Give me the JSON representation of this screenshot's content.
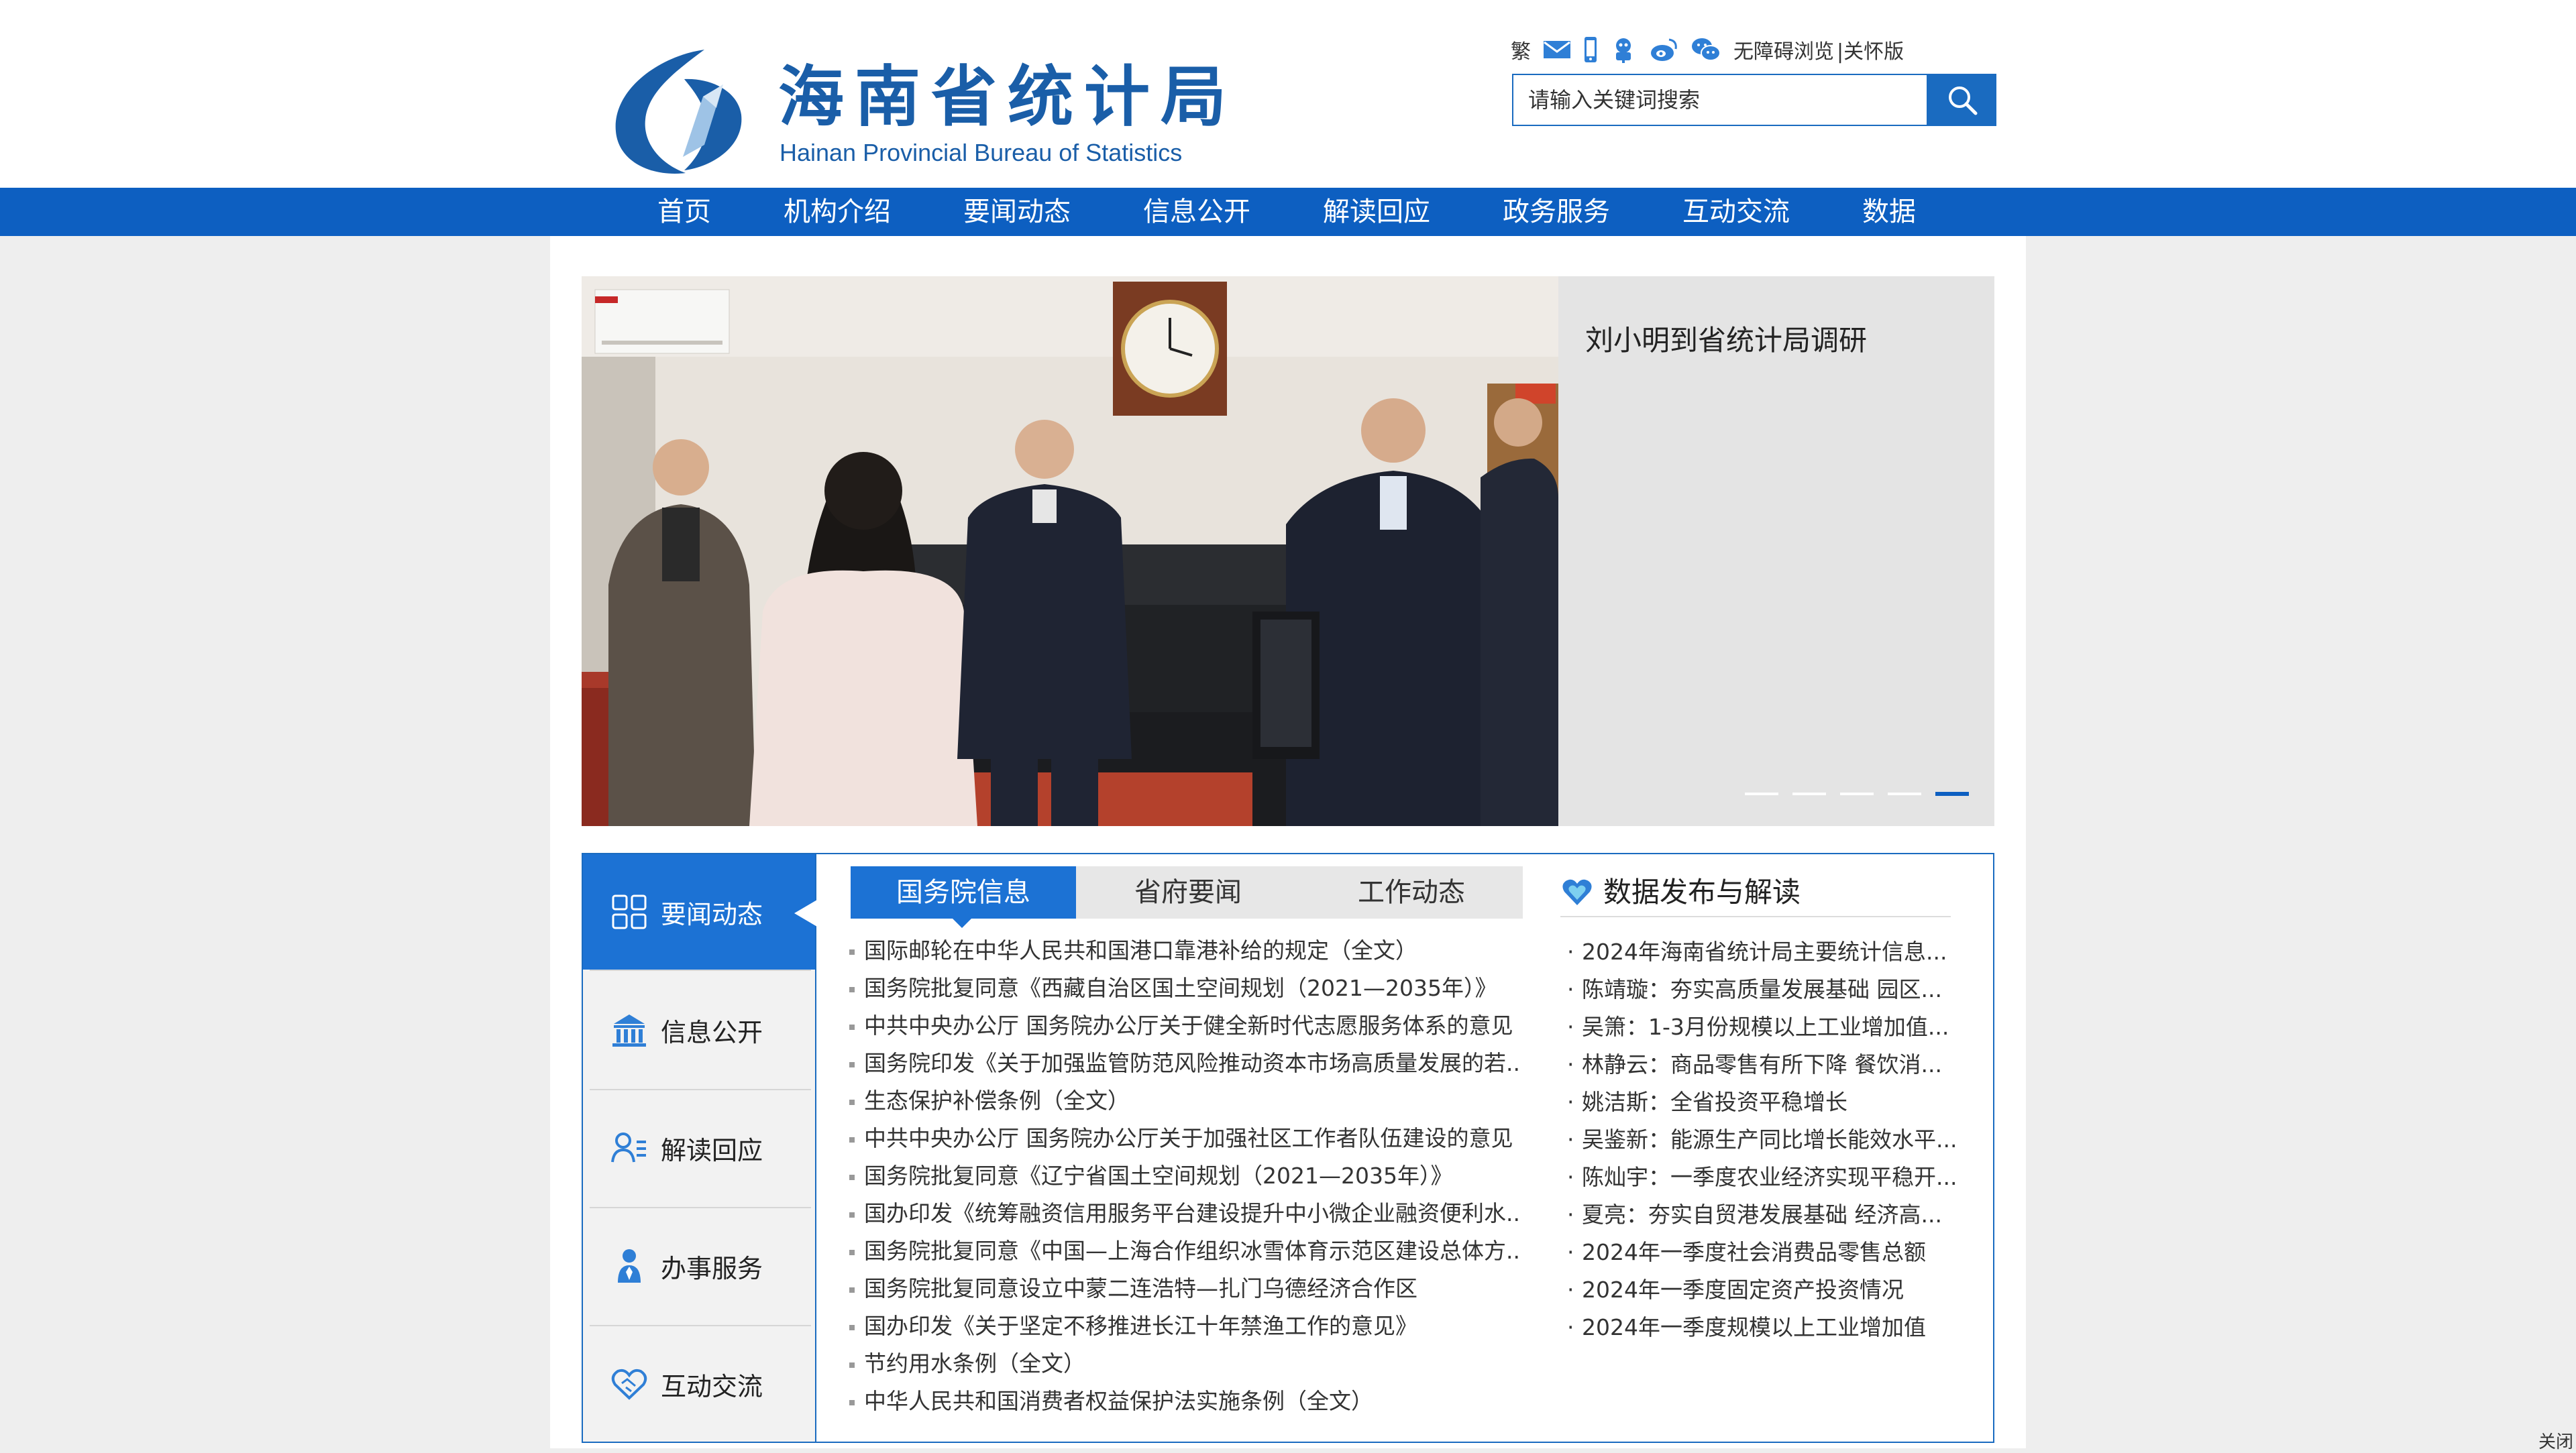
{
  "site": {
    "name_cn": "海南省统计局",
    "name_en": "Hainan Provincial Bureau of Statistics"
  },
  "top_tools": {
    "traditional_label": "繁",
    "accessibility_label": "无障碍浏览",
    "elder_label": "|关怀版",
    "icons": [
      "mail-icon",
      "mobile-icon",
      "robot-icon",
      "weibo-icon",
      "wechat-icon"
    ]
  },
  "search": {
    "placeholder": "请输入关键词搜索"
  },
  "nav": [
    {
      "label": "首页"
    },
    {
      "label": "机构介绍"
    },
    {
      "label": "要闻动态"
    },
    {
      "label": "信息公开"
    },
    {
      "label": "解读回应"
    },
    {
      "label": "政务服务"
    },
    {
      "label": "互动交流"
    },
    {
      "label": "数据"
    }
  ],
  "slider": {
    "caption": "刘小明到省统计局调研",
    "slide_count": 5,
    "active_index": 4
  },
  "side_menu": [
    {
      "label": "要闻动态",
      "icon": "grid-icon",
      "active": true
    },
    {
      "label": "信息公开",
      "icon": "building-icon",
      "active": false
    },
    {
      "label": "解读回应",
      "icon": "user-list-icon",
      "active": false
    },
    {
      "label": "办事服务",
      "icon": "person-icon",
      "active": false
    },
    {
      "label": "互动交流",
      "icon": "handshake-icon",
      "active": false
    }
  ],
  "tabs": [
    {
      "label": "国务院信息",
      "active": true
    },
    {
      "label": "省府要闻",
      "active": false
    },
    {
      "label": "工作动态",
      "active": false
    }
  ],
  "news": [
    "国际邮轮在中华人民共和国港口靠港补给的规定（全文）",
    "国务院批复同意《西藏自治区国土空间规划（2021—2035年）》",
    "中共中央办公厅 国务院办公厅关于健全新时代志愿服务体系的意见",
    "国务院印发《关于加强监管防范风险推动资本市场高质量发展的若...",
    "生态保护补偿条例（全文）",
    "中共中央办公厅 国务院办公厅关于加强社区工作者队伍建设的意见",
    "国务院批复同意《辽宁省国土空间规划（2021—2035年）》",
    "国办印发《统筹融资信用服务平台建设提升中小微企业融资便利水...",
    "国务院批复同意《中国—上海合作组织冰雪体育示范区建设总体方...",
    "国务院批复同意设立中蒙二连浩特—扎门乌德经济合作区",
    "国办印发《关于坚定不移推进长江十年禁渔工作的意见》",
    "节约用水条例（全文）",
    "中华人民共和国消费者权益保护法实施条例（全文）"
  ],
  "data_section": {
    "title": "数据发布与解读",
    "items": [
      "2024年海南省统计局主要统计信息...",
      "陈靖璇：夯实高质量发展基础 园区...",
      "吴箫：1-3月份规模以上工业增加值...",
      "林静云：商品零售有所下降 餐饮消...",
      "姚洁斯：全省投资平稳增长",
      "吴鉴新：能源生产同比增长能效水平...",
      "陈灿宇：一季度农业经济实现平稳开...",
      "夏亮：夯实自贸港发展基础 经济高...",
      "2024年一季度社会消费品零售总额",
      "2024年一季度固定资产投资情况",
      "2024年一季度规模以上工业增加值"
    ]
  },
  "close_label": "关闭",
  "colors": {
    "primary": "#0d5fc1",
    "accent": "#1c72d4",
    "logo": "#1a5ea8"
  }
}
